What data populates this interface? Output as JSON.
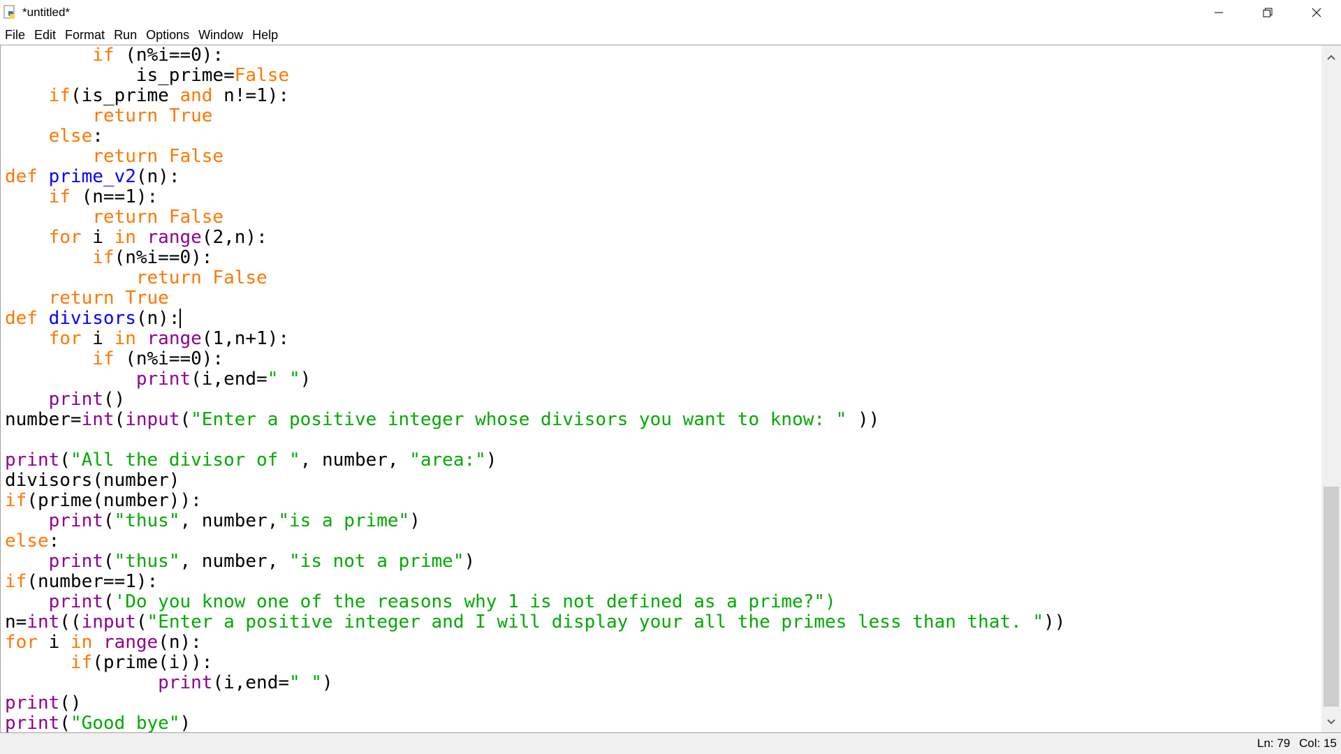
{
  "window": {
    "title": "*untitled*"
  },
  "menu": [
    "File",
    "Edit",
    "Format",
    "Run",
    "Options",
    "Window",
    "Help"
  ],
  "editor": {
    "caret_line": 13,
    "lines": [
      [
        {
          "t": "        "
        },
        {
          "t": "if",
          "c": "kw"
        },
        {
          "t": " (n%i==0):"
        }
      ],
      [
        {
          "t": "            is_prime="
        },
        {
          "t": "False",
          "c": "kw"
        }
      ],
      [
        {
          "t": "    "
        },
        {
          "t": "if",
          "c": "kw"
        },
        {
          "t": "(is_prime "
        },
        {
          "t": "and",
          "c": "kw"
        },
        {
          "t": " n!=1):"
        }
      ],
      [
        {
          "t": "        "
        },
        {
          "t": "return",
          "c": "kw"
        },
        {
          "t": " "
        },
        {
          "t": "True",
          "c": "kw"
        }
      ],
      [
        {
          "t": "    "
        },
        {
          "t": "else",
          "c": "kw"
        },
        {
          "t": ":"
        }
      ],
      [
        {
          "t": "        "
        },
        {
          "t": "return",
          "c": "kw"
        },
        {
          "t": " "
        },
        {
          "t": "False",
          "c": "kw"
        }
      ],
      [
        {
          "t": "def",
          "c": "kw"
        },
        {
          "t": " "
        },
        {
          "t": "prime_v2",
          "c": "df"
        },
        {
          "t": "(n):"
        }
      ],
      [
        {
          "t": "    "
        },
        {
          "t": "if",
          "c": "kw"
        },
        {
          "t": " (n==1):"
        }
      ],
      [
        {
          "t": "        "
        },
        {
          "t": "return",
          "c": "kw"
        },
        {
          "t": " "
        },
        {
          "t": "False",
          "c": "kw"
        }
      ],
      [
        {
          "t": "    "
        },
        {
          "t": "for",
          "c": "kw"
        },
        {
          "t": " i "
        },
        {
          "t": "in",
          "c": "kw"
        },
        {
          "t": " "
        },
        {
          "t": "range",
          "c": "bi"
        },
        {
          "t": "(2,n):"
        }
      ],
      [
        {
          "t": "        "
        },
        {
          "t": "if",
          "c": "kw"
        },
        {
          "t": "(n%i==0):"
        }
      ],
      [
        {
          "t": "            "
        },
        {
          "t": "return",
          "c": "kw"
        },
        {
          "t": " "
        },
        {
          "t": "False",
          "c": "kw"
        }
      ],
      [
        {
          "t": "    "
        },
        {
          "t": "return",
          "c": "kw"
        },
        {
          "t": " "
        },
        {
          "t": "True",
          "c": "kw"
        }
      ],
      [
        {
          "t": "def",
          "c": "kw"
        },
        {
          "t": " "
        },
        {
          "t": "divisors",
          "c": "df"
        },
        {
          "t": "(n):"
        }
      ],
      [
        {
          "t": "    "
        },
        {
          "t": "for",
          "c": "kw"
        },
        {
          "t": " i "
        },
        {
          "t": "in",
          "c": "kw"
        },
        {
          "t": " "
        },
        {
          "t": "range",
          "c": "bi"
        },
        {
          "t": "(1,n+1):"
        }
      ],
      [
        {
          "t": "        "
        },
        {
          "t": "if",
          "c": "kw"
        },
        {
          "t": " (n%i==0):"
        }
      ],
      [
        {
          "t": "            "
        },
        {
          "t": "print",
          "c": "bi"
        },
        {
          "t": "(i,end="
        },
        {
          "t": "\" \"",
          "c": "st"
        },
        {
          "t": ")"
        }
      ],
      [
        {
          "t": "    "
        },
        {
          "t": "print",
          "c": "bi"
        },
        {
          "t": "()"
        }
      ],
      [
        {
          "t": "number="
        },
        {
          "t": "int",
          "c": "bi"
        },
        {
          "t": "("
        },
        {
          "t": "input",
          "c": "bi"
        },
        {
          "t": "("
        },
        {
          "t": "\"Enter a positive integer whose divisors you want to know: \"",
          "c": "st"
        },
        {
          "t": " ))"
        }
      ],
      [
        {
          "t": ""
        }
      ],
      [
        {
          "t": "print",
          "c": "bi"
        },
        {
          "t": "("
        },
        {
          "t": "\"All the divisor of \"",
          "c": "st"
        },
        {
          "t": ", number, "
        },
        {
          "t": "\"area:\"",
          "c": "st"
        },
        {
          "t": ")"
        }
      ],
      [
        {
          "t": "divisors(number)"
        }
      ],
      [
        {
          "t": "if",
          "c": "kw"
        },
        {
          "t": "(prime(number)):"
        }
      ],
      [
        {
          "t": "    "
        },
        {
          "t": "print",
          "c": "bi"
        },
        {
          "t": "("
        },
        {
          "t": "\"thus\"",
          "c": "st"
        },
        {
          "t": ", number,"
        },
        {
          "t": "\"is a prime\"",
          "c": "st"
        },
        {
          "t": ")"
        }
      ],
      [
        {
          "t": "else",
          "c": "kw"
        },
        {
          "t": ":"
        }
      ],
      [
        {
          "t": "    "
        },
        {
          "t": "print",
          "c": "bi"
        },
        {
          "t": "("
        },
        {
          "t": "\"thus\"",
          "c": "st"
        },
        {
          "t": ", number, "
        },
        {
          "t": "\"is not a prime\"",
          "c": "st"
        },
        {
          "t": ")"
        }
      ],
      [
        {
          "t": "if",
          "c": "kw"
        },
        {
          "t": "(number==1):"
        }
      ],
      [
        {
          "t": "    "
        },
        {
          "t": "print",
          "c": "bi"
        },
        {
          "t": "("
        },
        {
          "t": "'Do you know one of the reasons why 1 is not defined as a prime?\")",
          "c": "st"
        }
      ],
      [
        {
          "t": "n="
        },
        {
          "t": "int",
          "c": "bi"
        },
        {
          "t": "(("
        },
        {
          "t": "input",
          "c": "bi"
        },
        {
          "t": "("
        },
        {
          "t": "\"Enter a positive integer and I will display your all the primes less than that. \"",
          "c": "st"
        },
        {
          "t": "))"
        }
      ],
      [
        {
          "t": "for",
          "c": "kw"
        },
        {
          "t": " i "
        },
        {
          "t": "in",
          "c": "kw"
        },
        {
          "t": " "
        },
        {
          "t": "range",
          "c": "bi"
        },
        {
          "t": "(n):"
        }
      ],
      [
        {
          "t": "      "
        },
        {
          "t": "if",
          "c": "kw"
        },
        {
          "t": "(prime(i)):"
        }
      ],
      [
        {
          "t": "              "
        },
        {
          "t": "print",
          "c": "bi"
        },
        {
          "t": "(i,end="
        },
        {
          "t": "\" \"",
          "c": "st"
        },
        {
          "t": ")"
        }
      ],
      [
        {
          "t": "print",
          "c": "bi"
        },
        {
          "t": "()"
        }
      ],
      [
        {
          "t": "print",
          "c": "bi"
        },
        {
          "t": "("
        },
        {
          "t": "\"Good bye\"",
          "c": "st"
        },
        {
          "t": ")"
        }
      ]
    ]
  },
  "status": {
    "line": "Ln: 79",
    "column": "Col: 15"
  },
  "scroll": {
    "thumb_start": 0.65,
    "thumb_end": 0.99
  },
  "colors": {
    "keyword": "#ff7700",
    "builtin": "#900090",
    "string": "#00aa00",
    "definition": "#0000ff"
  },
  "icons": {
    "app": "python-idle-icon",
    "minimize": "minimize-icon",
    "maximize": "restore-icon",
    "close": "close-icon",
    "scroll_up": "chevron-up-icon",
    "scroll_down": "chevron-down-icon"
  }
}
